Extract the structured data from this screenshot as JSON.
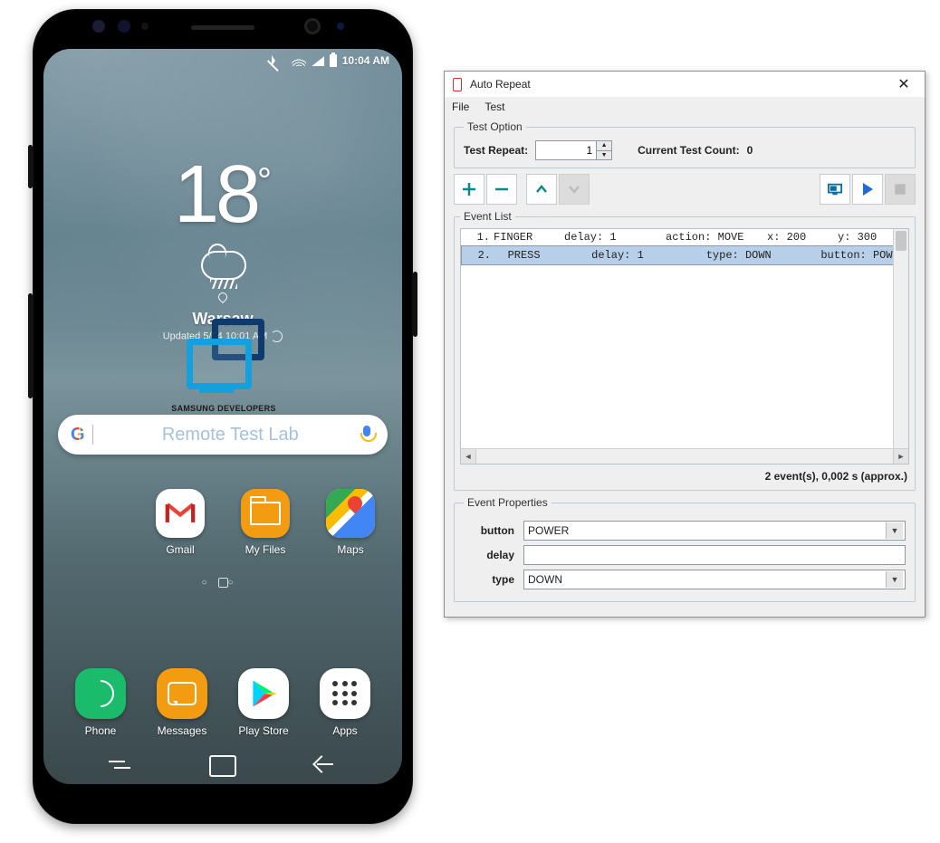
{
  "phone": {
    "status": {
      "time": "10:04 AM"
    },
    "weather": {
      "temp": "18",
      "deg": "°",
      "location": "Warsaw",
      "updated": "Updated 5/24 10:01 AM"
    },
    "logo_label_top": "SAMSUNG DEVELOPERS",
    "search_placeholder": "Remote Test Lab",
    "apps_row": {
      "gmail": "Gmail",
      "myfiles": "My Files",
      "maps": "Maps"
    },
    "dock": {
      "phone": "Phone",
      "messages": "Messages",
      "playstore": "Play Store",
      "apps": "Apps"
    }
  },
  "dialog": {
    "title": "Auto Repeat",
    "menu": {
      "file": "File",
      "test": "Test"
    },
    "option": {
      "legend": "Test Option",
      "repeat_label": "Test Repeat:",
      "repeat_value": "1",
      "count_label": "Current Test Count:",
      "count_value": "0"
    },
    "event_legend": "Event List",
    "events": [
      {
        "idx": "1.",
        "name": "FINGER",
        "k1": "delay:",
        "v1": "1",
        "k2": "action:",
        "v2": "MOVE",
        "k3": "x:",
        "v3": "200",
        "k4": "y:",
        "v4": "300"
      },
      {
        "idx": "2.",
        "name": "PRESS",
        "k1": "delay:",
        "v1": "1",
        "k2": "type:",
        "v2": "DOWN",
        "k3": "button:",
        "v3": "POWER",
        "k4": "",
        "v4": ""
      }
    ],
    "summary": "2  event(s),  0,002  s (approx.)",
    "props": {
      "legend": "Event Properties",
      "button_label": "button",
      "button_value": "POWER",
      "delay_label": "delay",
      "delay_value": "",
      "type_label": "type",
      "type_value": "DOWN"
    }
  }
}
